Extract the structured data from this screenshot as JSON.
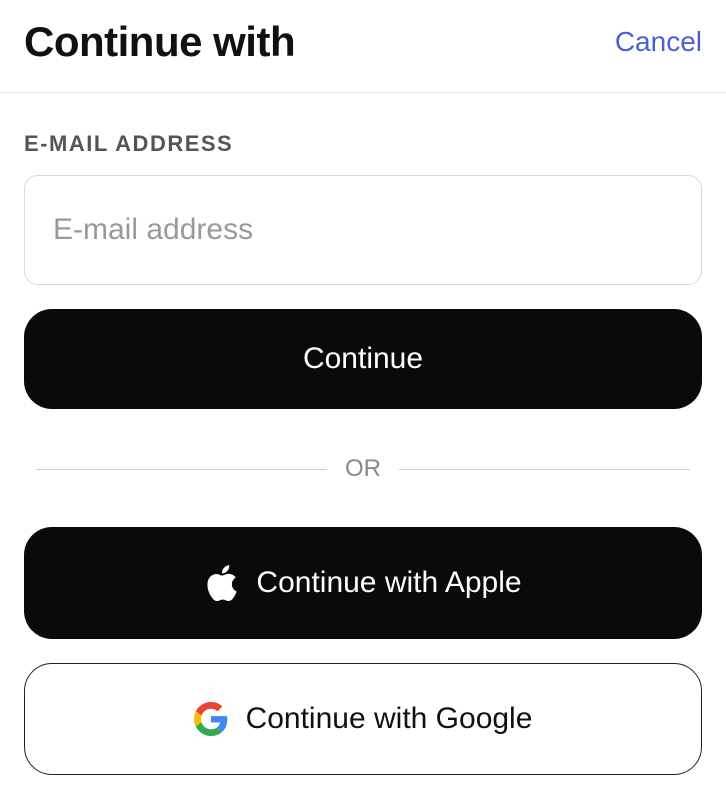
{
  "header": {
    "title": "Continue with",
    "cancel": "Cancel"
  },
  "form": {
    "email_label": "E-MAIL ADDRESS",
    "email_placeholder": "E-mail address",
    "continue_label": "Continue"
  },
  "divider": {
    "text": "OR"
  },
  "social": {
    "apple_label": "Continue with Apple",
    "google_label": "Continue with Google"
  }
}
